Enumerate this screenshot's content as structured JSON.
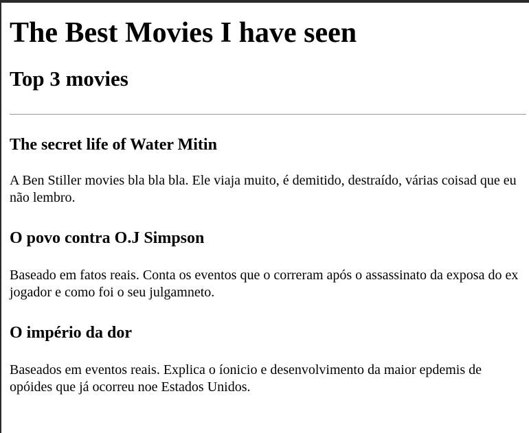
{
  "page": {
    "title": "The Best Movies I have seen",
    "subtitle": "Top 3 movies"
  },
  "movies": [
    {
      "title": "The secret life of Water Mitin",
      "description": "A Ben Stiller movies bla bla bla. Ele viaja muito, é demitido, destraído, várias coisad que eu não lembro."
    },
    {
      "title": "O povo contra O.J Simpson",
      "description": "Baseado em fatos reais. Conta os eventos que o correram após o assassinato da exposa do ex jogador e como foi o seu julgamneto."
    },
    {
      "title": "O império da dor",
      "description": "Baseados em eventos reais. Explica o íonicio e desenvolvimento da maior epdemis de opóides que já ocorreu noe Estados Unidos."
    }
  ]
}
